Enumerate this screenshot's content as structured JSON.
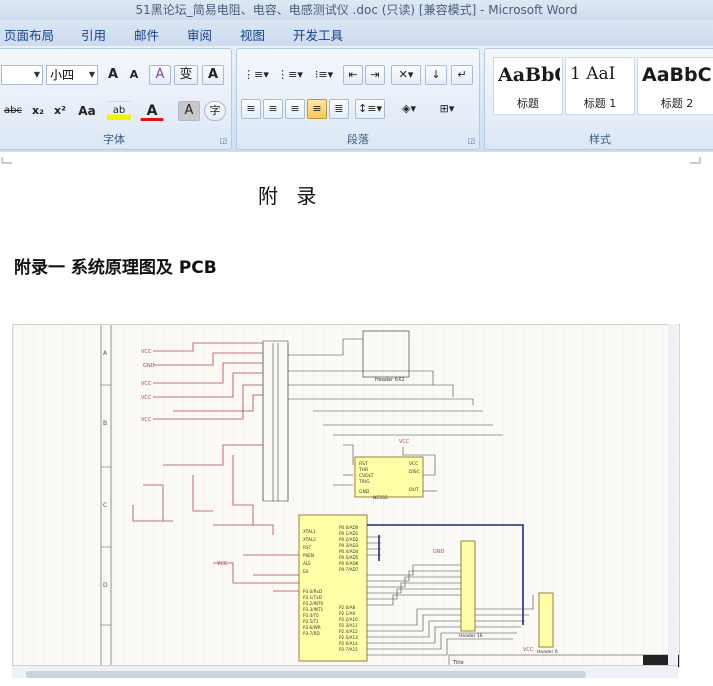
{
  "window": {
    "title": "51黑论坛_简易电阻、电容、电感测试仪 .doc (只读) [兼容模式] - Microsoft Word"
  },
  "tabs": [
    "页面布局",
    "引用",
    "邮件",
    "审阅",
    "视图",
    "开发工具"
  ],
  "ribbon": {
    "font_group": {
      "label": "字体",
      "font_size_value": "小四",
      "buttons": {
        "grow": "A",
        "shrink": "A",
        "clear_format": "A",
        "phonetic": "变",
        "char_border": "A",
        "strike": "abc",
        "subscript": "x₂",
        "superscript": "x²",
        "change_case": "Aa",
        "highlight": "ab",
        "font_color": "A",
        "char_shading": "A",
        "enclose": "字"
      }
    },
    "paragraph_group": {
      "label": "段落"
    },
    "styles_group": {
      "label": "样式",
      "styles": [
        {
          "sample": "AaBbC",
          "name": "标题"
        },
        {
          "sample": "1   AaI",
          "name": "标题 1"
        },
        {
          "sample": "AaBbC",
          "name": "标题 2"
        }
      ]
    }
  },
  "document": {
    "appendix_title": "附  录",
    "appendix_heading": "附录一   系统原理图及 PCB",
    "schematic": {
      "row_markers": [
        "A",
        "B",
        "C",
        "D"
      ],
      "labels": {
        "vcc": "VCC",
        "gnd": "GND",
        "header_u1": "Header 6X2",
        "ic_555": "NE555",
        "mcu_pins_left": [
          "XTAL1",
          "XTAL2",
          "RST",
          "PSEN",
          "ALE",
          "EA"
        ],
        "mcu_p0": [
          "P0.0/AD0",
          "P0.1/AD1",
          "P0.2/AD2",
          "P0.3/AD3",
          "P0.4/AD4",
          "P0.5/AD5",
          "P0.6/AD6",
          "P0.7/AD7"
        ],
        "mcu_p3": [
          "P3.0/RxD",
          "P3.1/TxD",
          "P3.2/INT0",
          "P3.3/INT1",
          "P3.4/T0",
          "P3.5/T1",
          "P3.6/WR",
          "P3.7/RD"
        ],
        "mcu_p2": [
          "P2.0/A8",
          "P2.1/A9",
          "P2.2/A10",
          "P2.3/A11",
          "P2.4/A12",
          "P2.5/A13",
          "P2.6/A14",
          "P2.7/A15"
        ],
        "header_16": "Header 16",
        "header_6": "Header 6",
        "title_block": "Title",
        "555_pins": [
          "RST",
          "THR",
          "CVOLT",
          "TRIG",
          "VCC",
          "DISC",
          "OUT",
          "GND"
        ]
      }
    }
  },
  "colors": {
    "ribbon_bg": "#d9e6f6",
    "title_text": "#4a5d7a",
    "tab_text": "#15428b",
    "wire_red": "#b5484a",
    "wire_blue": "#1d2a8a",
    "ic_fill": "#ffffa8"
  }
}
